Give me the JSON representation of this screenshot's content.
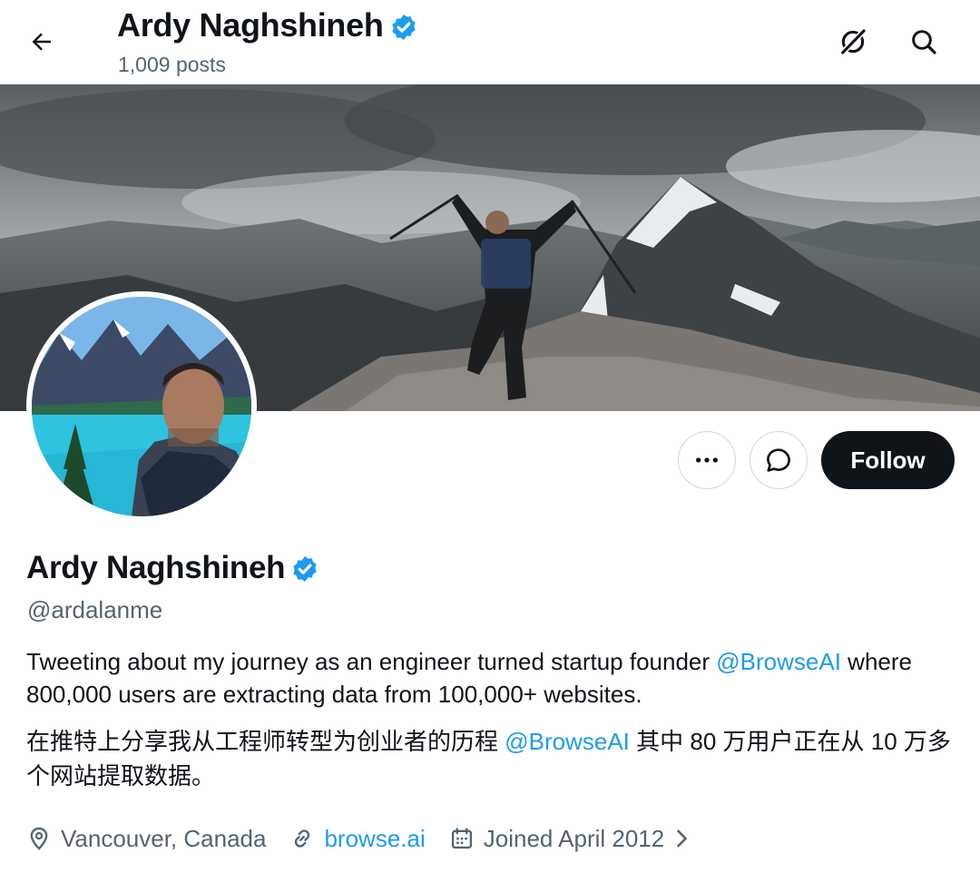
{
  "header": {
    "name": "Ardy Naghshineh",
    "post_count": "1,009 posts"
  },
  "profile": {
    "name": "Ardy Naghshineh",
    "handle": "@ardalanme",
    "follow_label": "Follow",
    "bio": {
      "en_text": "Tweeting about my journey as an engineer turned startup founder",
      "en_mention": "@BrowseAI",
      "en_rest": "where 800,000 users are extracting data from 100,000+ websites.",
      "zh_text": "在推特上分享我从工程师转型为创业者的历程",
      "zh_mention": "@BrowseAI",
      "zh_rest": "其中 80 万用户正在从 10 万多个网站提取数据。"
    },
    "location": "Vancouver, Canada",
    "website": "browse.ai",
    "joined": "Joined April 2012"
  },
  "colors": {
    "accent": "#1d9bf0",
    "text": "#0f1419",
    "muted": "#536471",
    "border": "#cfd9de"
  },
  "icons": {
    "back": "arrow-left-icon",
    "grok": "grok-icon",
    "search": "search-icon",
    "verified": "verified-badge-icon",
    "more": "more-icon",
    "message": "message-icon",
    "location": "location-pin-icon",
    "link": "link-icon",
    "calendar": "calendar-icon",
    "chevron": "chevron-right-icon"
  }
}
